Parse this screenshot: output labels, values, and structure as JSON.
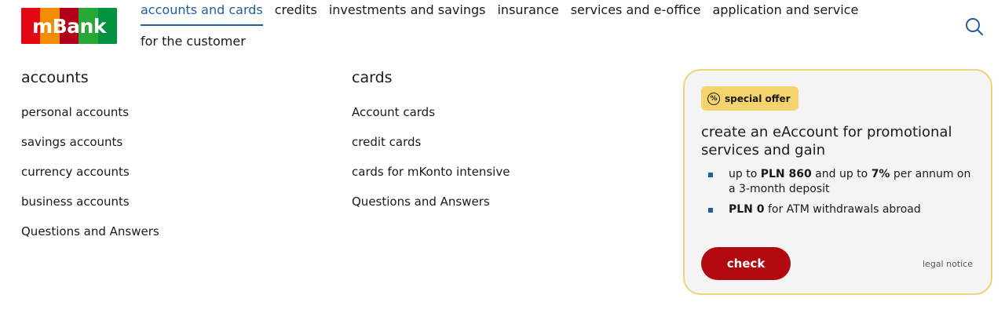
{
  "logo": {
    "text": "mBank",
    "stripes": [
      "#e30613",
      "#f28c00",
      "#b3001b",
      "#27a836",
      "#00923f"
    ]
  },
  "nav": {
    "row1": [
      {
        "label": "accounts and cards",
        "active": true
      },
      {
        "label": "credits"
      },
      {
        "label": "investments and savings"
      },
      {
        "label": "insurance"
      },
      {
        "label": "services and e-office"
      },
      {
        "label": "application and service"
      }
    ],
    "row2": [
      {
        "label": "for the customer"
      }
    ],
    "search_icon": "search-icon"
  },
  "accounts": {
    "title": "accounts",
    "items": [
      "personal accounts",
      "savings accounts",
      "currency accounts",
      "business accounts",
      "Questions and Answers"
    ]
  },
  "cards": {
    "title": "cards",
    "items": [
      "Account cards",
      "credit cards",
      "cards for mKonto intensive",
      "Questions and Answers"
    ]
  },
  "promo": {
    "badge": "special offer",
    "badge_icon": "percent-icon",
    "title": "create an eAccount for promotional services and gain",
    "bullet1": {
      "pre": "up to ",
      "b1": "PLN 860",
      "mid": " and up to ",
      "b2": "7%",
      "post": " per annum on a 3-month deposit"
    },
    "bullet2": {
      "b1": "PLN 0",
      "post": " for ATM withdrawals abroad"
    },
    "check_label": "check",
    "legal_label": "legal notice"
  },
  "colors": {
    "accent_blue": "#1f5fa0",
    "brand_red": "#b2080f",
    "badge_yellow": "#f5d46d",
    "card_border": "#f0d27a"
  }
}
